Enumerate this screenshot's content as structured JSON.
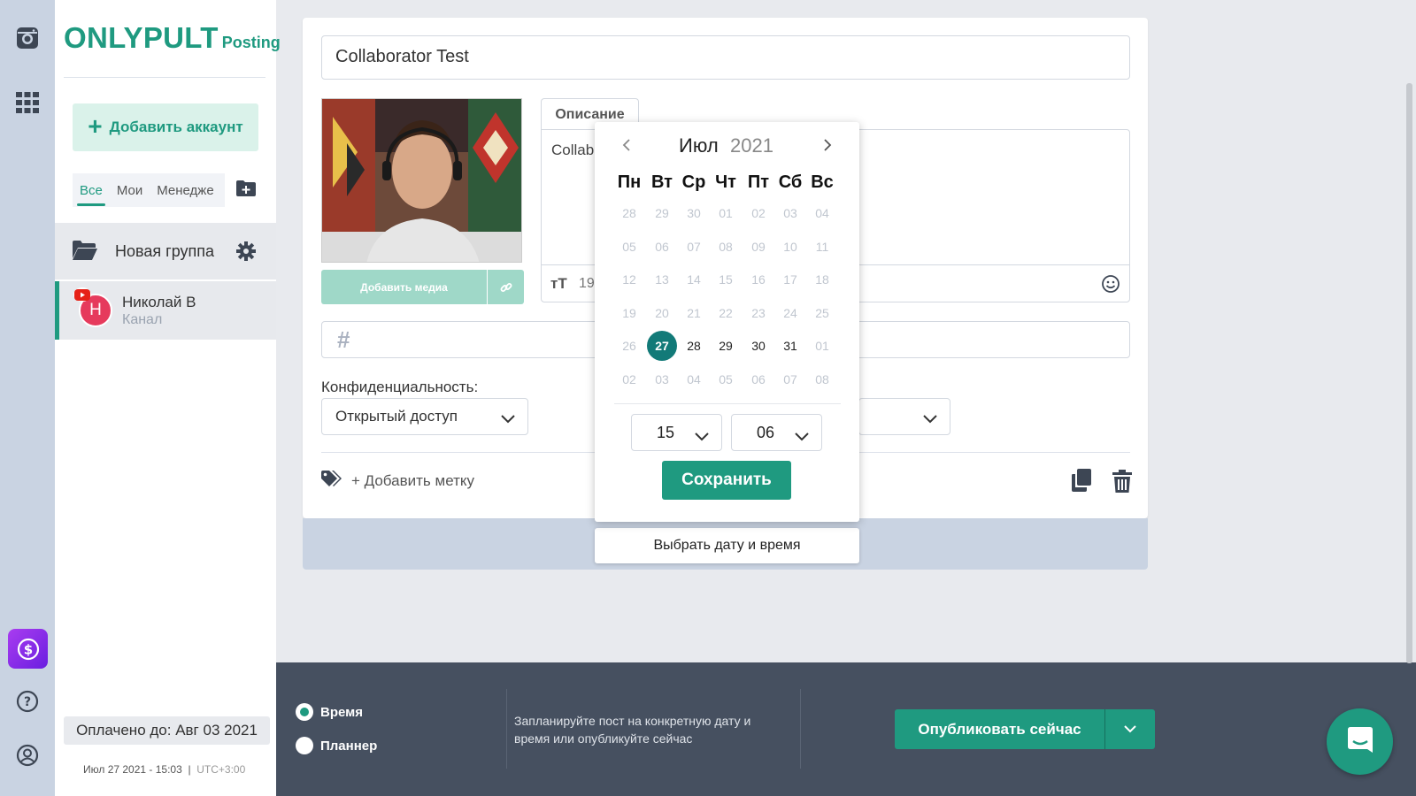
{
  "brand": {
    "name": "ONLYPULT",
    "product": "Posting"
  },
  "sidebar": {
    "add_account": "Добавить аккаунт",
    "tabs": [
      {
        "label": "Все"
      },
      {
        "label": "Мои"
      },
      {
        "label": "Менедже"
      }
    ],
    "group": {
      "label": "Новая группа"
    },
    "account": {
      "initial": "Н",
      "name": "Николай В",
      "type": "Канал"
    },
    "paid_until": "Оплачено до: Авг 03 2021",
    "datetime": "Июл 27 2021 - 15:03",
    "timezone": "UTC+3:00"
  },
  "post": {
    "title": "Collaborator Test",
    "add_media": "Добавить медиа",
    "description_tab": "Описание",
    "description_text": "Collab",
    "char_count": "19",
    "hashtag_symbol": "#",
    "privacy_label": "Конфиденциальность:",
    "privacy_value": "Открытый доступ",
    "add_tag": "+ Добавить метку",
    "choose_datetime": "Выбрать дату и время"
  },
  "calendar": {
    "month": "Июл",
    "year": "2021",
    "weekdays": [
      "Пн",
      "Вт",
      "Ср",
      "Чт",
      "Пт",
      "Сб",
      "Вс"
    ],
    "weeks": [
      [
        "28",
        "29",
        "30",
        "01",
        "02",
        "03",
        "04"
      ],
      [
        "05",
        "06",
        "07",
        "08",
        "09",
        "10",
        "11"
      ],
      [
        "12",
        "13",
        "14",
        "15",
        "16",
        "17",
        "18"
      ],
      [
        "19",
        "20",
        "21",
        "22",
        "23",
        "24",
        "25"
      ],
      [
        "26",
        "27",
        "28",
        "29",
        "30",
        "31",
        "01"
      ],
      [
        "02",
        "03",
        "04",
        "05",
        "06",
        "07",
        "08"
      ]
    ],
    "selected_day": "27",
    "hour": "15",
    "minute": "06",
    "save": "Сохранить"
  },
  "bottom": {
    "mode_time": "Время",
    "mode_planner": "Планнер",
    "selected_mode": "Время",
    "hint": "Запланируйте пост на конкретную дату и время или опубликуйте сейчас",
    "publish_now": "Опубликовать сейчас"
  },
  "colors": {
    "accent": "#1f9a80",
    "selected_day": "#127a78",
    "bottom_bar": "#465060",
    "rail": "#c9d3e2"
  },
  "icons": [
    "instagram-icon",
    "apps-grid-icon",
    "dollar-icon",
    "help-icon",
    "profile-icon",
    "folder-add-icon",
    "folder-icon",
    "gear-icon",
    "youtube-icon",
    "link-icon",
    "text-size-icon",
    "smile-icon",
    "tag-icon",
    "copy-icon",
    "trash-icon",
    "chevron-left-icon",
    "chevron-right-icon",
    "chevron-down-icon",
    "chat-icon"
  ]
}
